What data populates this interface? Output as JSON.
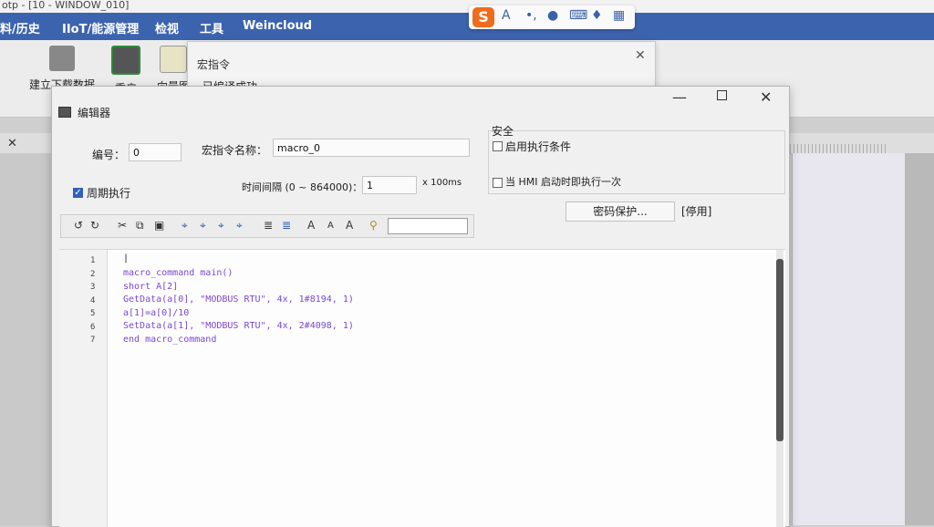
{
  "app": {
    "title": "otp - [10 - WINDOW_010]",
    "menu": [
      "料/历史",
      "IIoT/能源管理",
      "检视",
      "工具",
      "Weincloud"
    ],
    "ribbon": [
      "建立下载数据",
      "重启",
      "向量图"
    ]
  },
  "ime": {
    "logo": "S",
    "mode": "A",
    "punct": "•,",
    "mic": "mic-icon",
    "keyboard": "keyboard-icon",
    "skin": "shirt-icon",
    "menu": "grid-icon"
  },
  "macro_dialog": {
    "title": "宏指令",
    "status": "已编译成功"
  },
  "editor": {
    "title": "编辑器",
    "id_label": "编号：",
    "id_value": "0",
    "name_label": "宏指令名称：",
    "name_value": "macro_0",
    "security_label": "安全",
    "enable_condition_label": "启用执行条件",
    "enable_condition_checked": false,
    "periodic_label": "周期执行",
    "periodic_checked": true,
    "interval_label": "时间间隔 (0 ~ 864000)：",
    "interval_value": "1",
    "interval_unit": "x 100ms",
    "run_once_label": "当 HMI 启动时即执行一次",
    "run_once_checked": false,
    "password_button": "密码保护...",
    "disabled_label": "[停用]",
    "toolbar": [
      "↺",
      "↻",
      "✂",
      "⧉",
      "📋",
      "⌖",
      "⌖",
      "⌖",
      "⌖",
      "≣",
      "≣",
      "A",
      "A",
      "A",
      "⚲"
    ],
    "line_numbers": [
      "1",
      "2",
      "3",
      "4",
      "5",
      "6",
      "7"
    ],
    "code": [
      "",
      "macro_command main()",
      "short A[2]",
      "GetData(a[0], \"MODBUS RTU\", 4x, 1#8194, 1)",
      "a[1]=a[0]/10",
      "SetData(a[1], \"MODBUS RTU\", 4x, 2#4098, 1)",
      "end macro_command"
    ]
  }
}
